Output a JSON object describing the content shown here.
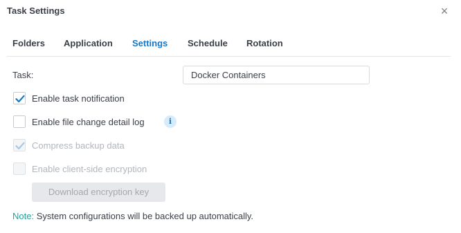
{
  "dialog": {
    "title": "Task Settings",
    "close_glyph": "×"
  },
  "tabs": [
    {
      "label": "Folders",
      "active": false
    },
    {
      "label": "Application",
      "active": false
    },
    {
      "label": "Settings",
      "active": true
    },
    {
      "label": "Schedule",
      "active": false
    },
    {
      "label": "Rotation",
      "active": false
    }
  ],
  "task": {
    "label": "Task:",
    "value": "Docker Containers"
  },
  "options": [
    {
      "label": "Enable task notification",
      "checked": true,
      "disabled": false
    },
    {
      "label": "Enable file change detail log",
      "checked": false,
      "disabled": false,
      "info_icon": "info-icon"
    },
    {
      "label": "Compress backup data",
      "checked": true,
      "disabled": true
    },
    {
      "label": "Enable client-side encryption",
      "checked": false,
      "disabled": true
    }
  ],
  "download_button": {
    "label": "Download encryption key",
    "disabled": true
  },
  "note": {
    "label": "Note:",
    "text": " System configurations will be backed up automatically."
  },
  "colors": {
    "accent": "#1778c7",
    "note": "#1ba39c",
    "disabled_text": "#b2b6bc"
  }
}
